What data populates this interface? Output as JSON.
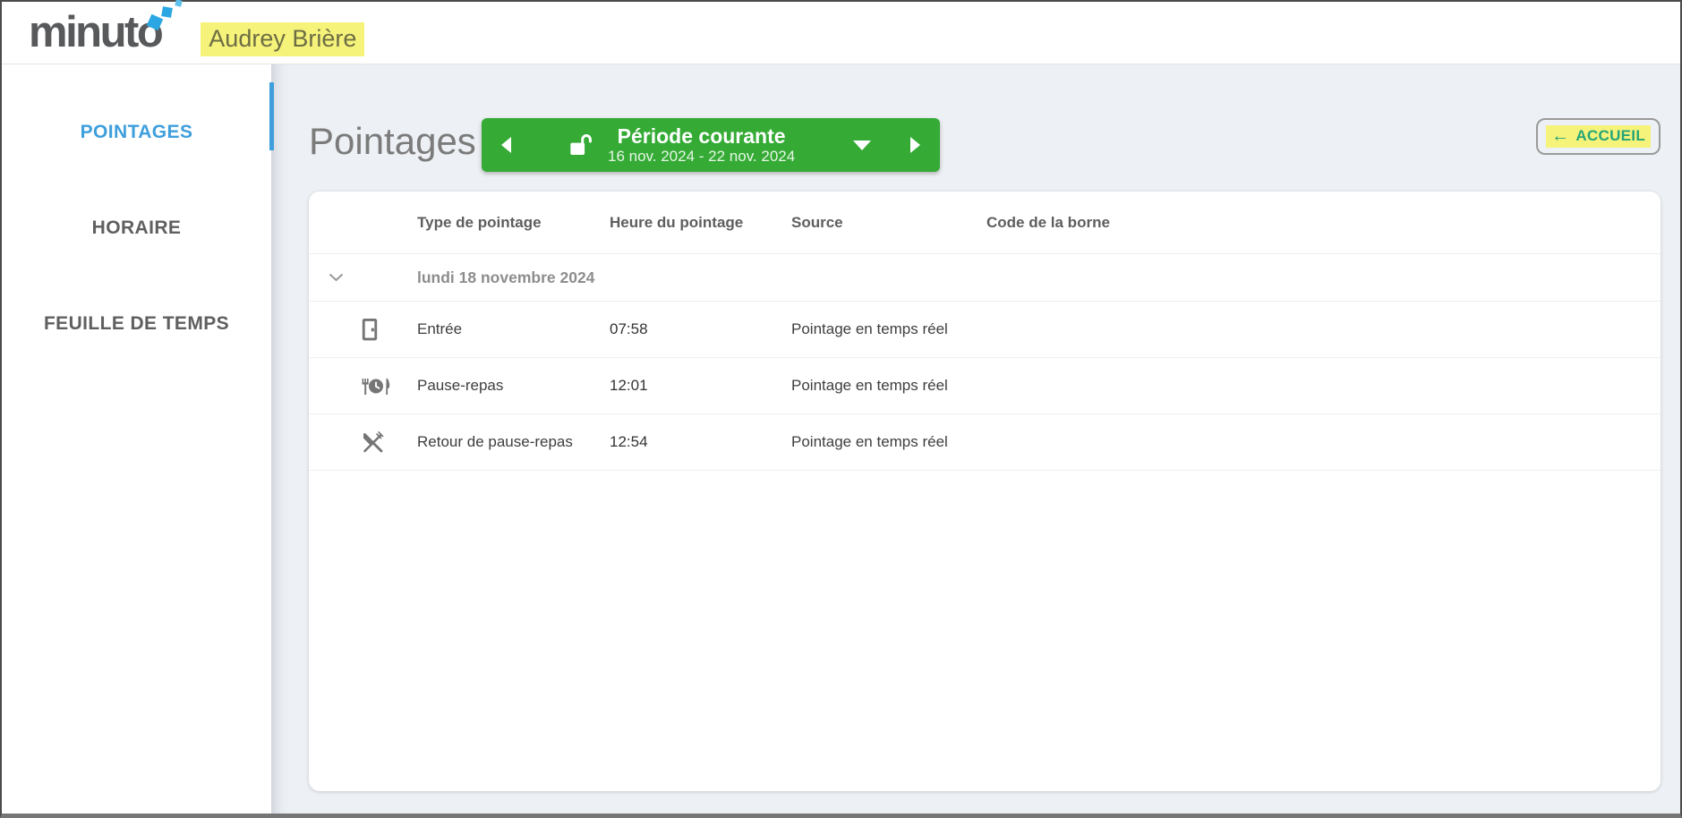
{
  "colors": {
    "accent_blue": "#3f9fdc",
    "green": "#35ab35",
    "highlight_yellow": "#f5f37a",
    "accueil_teal": "#26a578"
  },
  "header": {
    "logo": "minuto",
    "user_name": "Audrey Brière"
  },
  "sidebar": {
    "items": [
      {
        "label": "POINTAGES",
        "active": true
      },
      {
        "label": "HORAIRE",
        "active": false
      },
      {
        "label": "FEUILLE DE TEMPS",
        "active": false
      }
    ]
  },
  "page": {
    "title": "Pointages"
  },
  "period_selector": {
    "title": "Période courante",
    "range": "16 nov. 2024 - 22 nov. 2024"
  },
  "accueil_button": {
    "arrow": "←",
    "label": "ACCUEIL"
  },
  "table": {
    "columns": [
      "Type de pointage",
      "Heure du pointage",
      "Source",
      "Code de la borne"
    ],
    "group_label": "lundi 18 novembre 2024",
    "rows": [
      {
        "icon": "door-entry-icon",
        "type": "Entrée",
        "time": "07:58",
        "source": "Pointage en temps réel",
        "terminal": ""
      },
      {
        "icon": "meal-break-icon",
        "type": "Pause-repas",
        "time": "12:01",
        "source": "Pointage en temps réel",
        "terminal": ""
      },
      {
        "icon": "meal-return-icon",
        "type": "Retour de pause-repas",
        "time": "12:54",
        "source": "Pointage en temps réel",
        "terminal": ""
      }
    ]
  }
}
